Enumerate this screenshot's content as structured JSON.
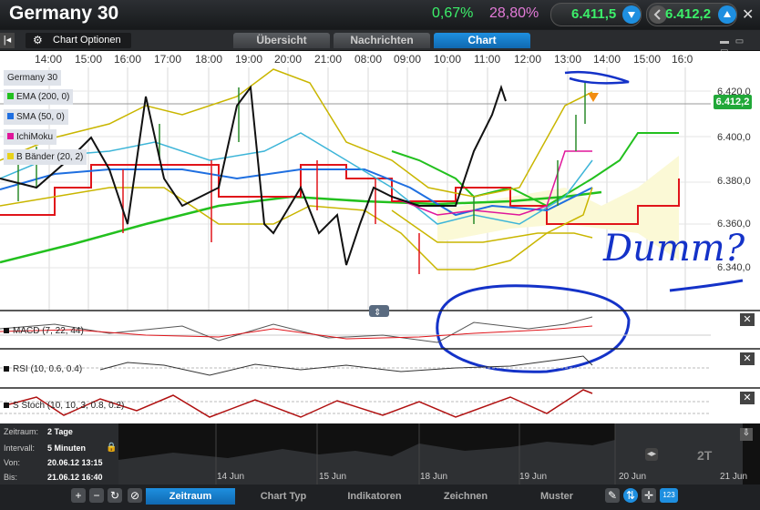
{
  "header": {
    "title": "Germany 30",
    "change_pct": "0,67%",
    "volatility_pct": "28,80%",
    "bid": "6.411,5",
    "ask": "6.412,2"
  },
  "toolbar_top": {
    "chart_options_label": "Chart Optionen",
    "tabs": [
      {
        "label": "Übersicht"
      },
      {
        "label": "Nachrichten"
      },
      {
        "label": "Chart"
      }
    ]
  },
  "chart": {
    "time_labels": [
      "14:00",
      "15:00",
      "16:00",
      "17:00",
      "18:00",
      "19:00",
      "20:00",
      "21:00",
      "08:00",
      "09:00",
      "10:00",
      "11:00",
      "12:00",
      "13:00",
      "14:00",
      "15:00",
      "16:0"
    ],
    "price_labels": [
      "6.420,0",
      "6.400,0",
      "6.380,0",
      "6.360,0",
      "6.340,0"
    ],
    "current_price": "6.412,2",
    "legend": [
      {
        "label": "Germany 30",
        "color": ""
      },
      {
        "label": "EMA (200, 0)",
        "color": "#22c01e"
      },
      {
        "label": "SMA (50, 0)",
        "color": "#1f6fe0"
      },
      {
        "label": "IchiMoku",
        "color": "#e0169a"
      },
      {
        "label": "B Bänder (20, 2)",
        "color": "#e8d21a"
      }
    ],
    "annotation_text": "Dumm?"
  },
  "indicators": [
    {
      "label": "MACD (7, 22, 44)"
    },
    {
      "label": "RSI (10, 0.6, 0.4)"
    },
    {
      "label": "S Stoch (10, 10, 3, 0.8, 0.2)"
    }
  ],
  "navigator": {
    "zeitraum_label": "Zeitraum:",
    "zeitraum_value": "2 Tage",
    "intervall_label": "Intervall:",
    "intervall_value": "5 Minuten",
    "von_label": "Von:",
    "von_value": "20.06.12 13:15",
    "bis_label": "Bis:",
    "bis_value": "21.06.12 16:40",
    "day_labels": [
      "14 Jun",
      "15 Jun",
      "18 Jun",
      "19 Jun",
      "20 Jun",
      "21 Jun"
    ],
    "range_badge": "2T"
  },
  "bottom_tabs": [
    {
      "label": "Zeitraum"
    },
    {
      "label": "Chart Typ"
    },
    {
      "label": "Indikatoren"
    },
    {
      "label": "Zeichnen"
    },
    {
      "label": "Muster"
    }
  ],
  "colors": {
    "accent": "#1e8fe0",
    "positive": "#3cf06a",
    "volatility": "#e37bd8"
  },
  "icons": [
    "back-icon",
    "gear-icon",
    "window-icons",
    "plus-icon",
    "minus-icon",
    "refresh-icon",
    "cancel-icon",
    "pencil-icon",
    "arrows-icon",
    "zoom-icon",
    "counter-icon"
  ]
}
